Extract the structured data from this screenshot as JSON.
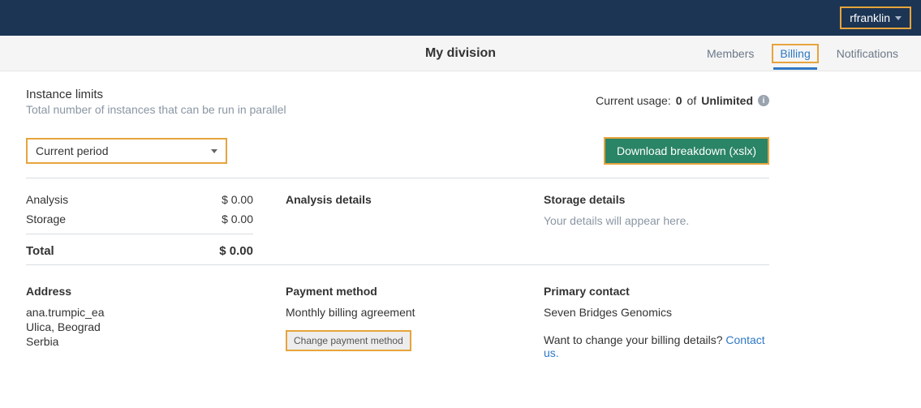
{
  "topbar": {
    "username": "rfranklin"
  },
  "subheader": {
    "title": "My division",
    "tabs": [
      {
        "label": "Members",
        "active": false
      },
      {
        "label": "Billing",
        "active": true
      },
      {
        "label": "Notifications",
        "active": false
      }
    ]
  },
  "instance_limits": {
    "title": "Instance limits",
    "subtitle": "Total number of instances that can be run in parallel",
    "usage_label": "Current usage: ",
    "usage_value": "0",
    "usage_of": " of ",
    "usage_limit": "Unlimited"
  },
  "controls": {
    "period": "Current period",
    "download_label": "Download breakdown (xslx)"
  },
  "costs": {
    "rows": [
      {
        "label": "Analysis",
        "value": "$ 0.00"
      },
      {
        "label": "Storage",
        "value": "$ 0.00"
      }
    ],
    "total_label": "Total",
    "total_value": "$ 0.00"
  },
  "analysis_details": {
    "heading": "Analysis details"
  },
  "storage_details": {
    "heading": "Storage details",
    "empty_text": "Your details will appear here."
  },
  "address": {
    "heading": "Address",
    "lines": [
      "ana.trumpic_ea",
      "Ulica, Beograd",
      "Serbia"
    ]
  },
  "payment": {
    "heading": "Payment method",
    "text": "Monthly billing agreement",
    "button": "Change payment method"
  },
  "contact": {
    "heading": "Primary contact",
    "company": "Seven Bridges Genomics",
    "prompt": "Want to change your billing details? ",
    "link": "Contact us."
  }
}
